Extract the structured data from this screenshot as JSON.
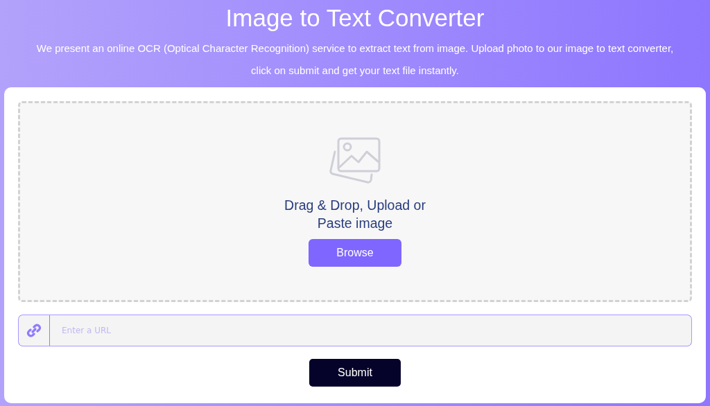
{
  "header": {
    "title": "Image to Text Converter",
    "description": "We present an online OCR (Optical Character Recognition) service to extract text from image. Upload photo to our image to text converter, click on submit and get your text file instantly."
  },
  "dropzone": {
    "prompt": "Drag & Drop, Upload or Paste image",
    "button": "Browse"
  },
  "url_field": {
    "placeholder": "Enter a URL"
  },
  "submit_button": "Submit"
}
